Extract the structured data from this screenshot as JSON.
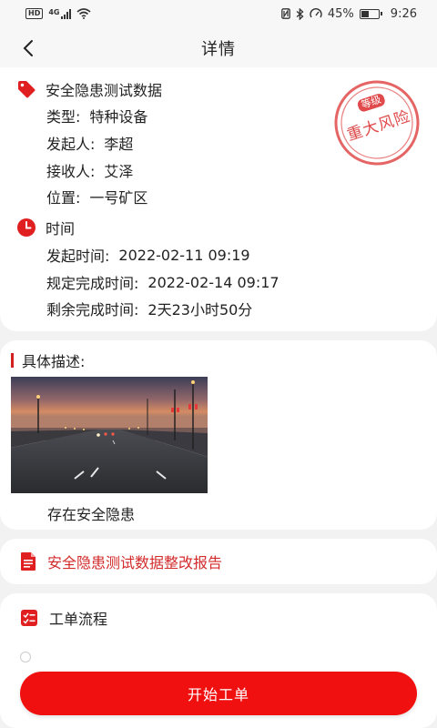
{
  "status_bar": {
    "network": "HD",
    "signal": "4G",
    "battery": "45%",
    "time": "9:26"
  },
  "header": {
    "title": "详情"
  },
  "info": {
    "title": "安全隐患测试数据",
    "type_label": "类型:",
    "type_value": "特种设备",
    "initiator_label": "发起人:",
    "initiator_value": "李超",
    "receiver_label": "接收人:",
    "receiver_value": "艾泽",
    "location_label": "位置:",
    "location_value": "一号矿区",
    "stamp_level": "等级",
    "stamp_text": "重大风险",
    "time_section": "时间",
    "start_label": "发起时间:",
    "start_value": "2022-02-11 09:19",
    "due_label": "规定完成时间:",
    "due_value": "2022-02-14 09:17",
    "remain_label": "剩余完成时间:",
    "remain_value": "2天23小时50分"
  },
  "description": {
    "label": "具体描述:",
    "text": "存在安全隐患"
  },
  "report": {
    "label": "安全隐患测试数据整改报告"
  },
  "flow": {
    "label": "工单流程"
  },
  "actions": {
    "start_label": "开始工单"
  },
  "colors": {
    "accent": "#f01010",
    "icon_red": "#e02020",
    "report_text": "#d32a2a"
  }
}
